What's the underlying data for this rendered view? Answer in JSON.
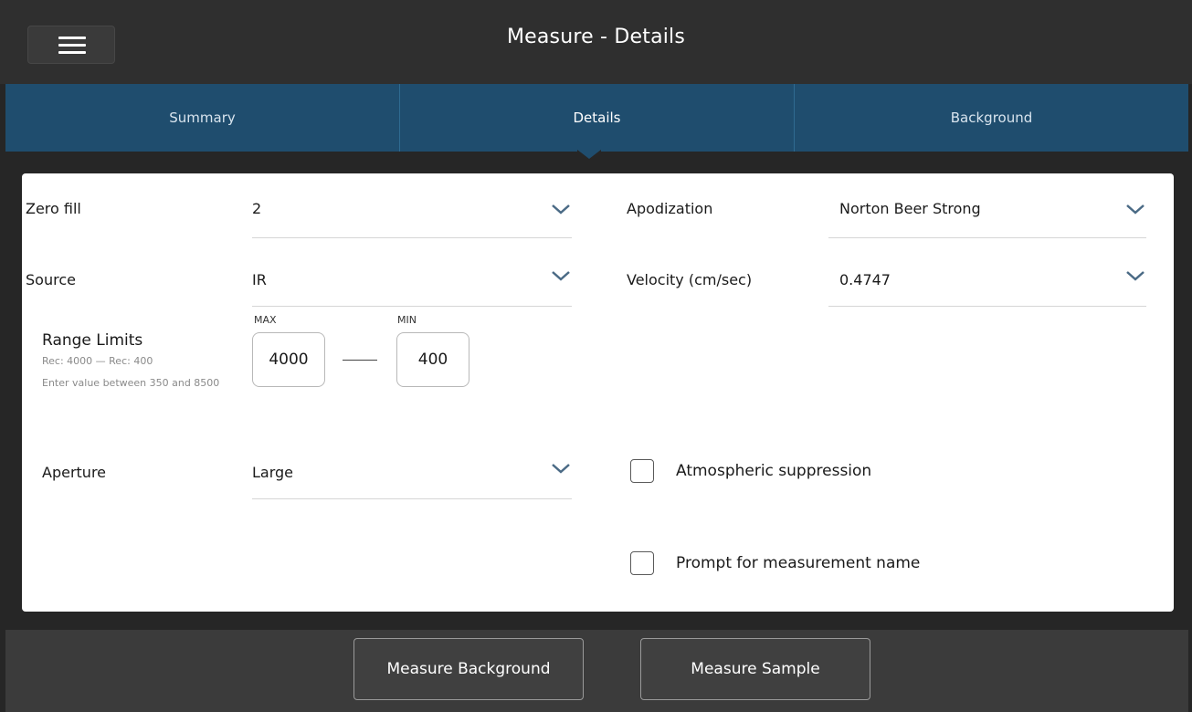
{
  "header": {
    "title": "Measure - Details",
    "menu_icon": "hamburger-menu-icon"
  },
  "tabs": [
    {
      "label": "Summary",
      "active": false
    },
    {
      "label": "Details",
      "active": true
    },
    {
      "label": "Background",
      "active": false
    }
  ],
  "form": {
    "zero_fill": {
      "label": "Zero fill",
      "value": "2"
    },
    "source": {
      "label": "Source",
      "value": "IR"
    },
    "apodization": {
      "label": "Apodization",
      "value": "Norton Beer Strong"
    },
    "velocity": {
      "label": "Velocity (cm/sec)",
      "value": "0.4747"
    },
    "range_limits": {
      "label": "Range Limits",
      "recommendation": "Rec: 4000 — Rec: 400",
      "hint": "Enter value between 350 and 8500",
      "max_label": "MAX",
      "max_value": "4000",
      "min_label": "MIN",
      "min_value": "400"
    },
    "aperture": {
      "label": "Aperture",
      "value": "Large"
    },
    "atmospheric_suppression": {
      "label": "Atmospheric suppression",
      "checked": false
    },
    "prompt_name": {
      "label": "Prompt for measurement name",
      "checked": false
    }
  },
  "footer": {
    "measure_background": "Measure Background",
    "measure_sample": "Measure Sample"
  },
  "colors": {
    "tab_bar": "#1f4d6e",
    "background": "#262626",
    "panel": "#ffffff"
  }
}
